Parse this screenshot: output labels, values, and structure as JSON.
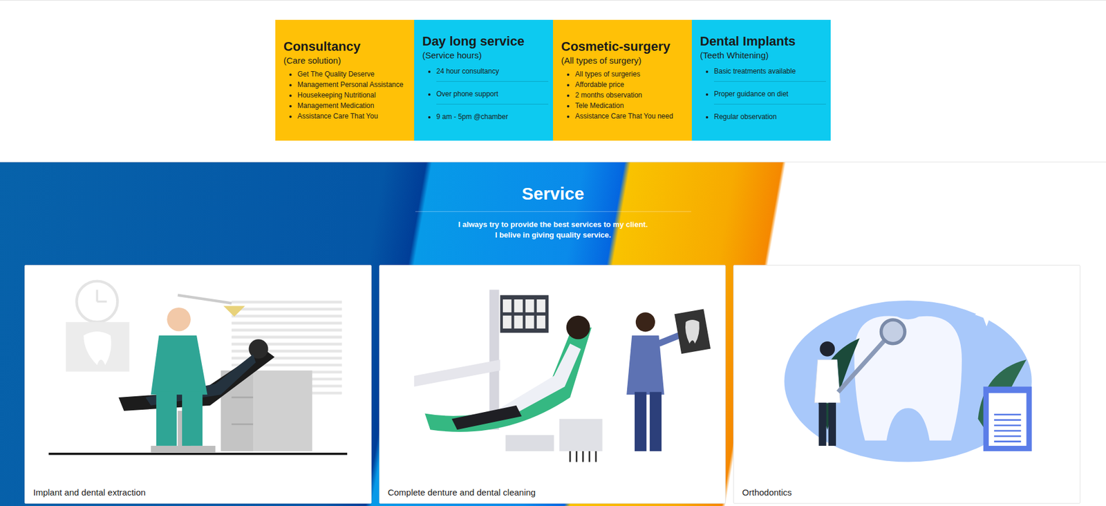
{
  "features": [
    {
      "title": "Consultancy",
      "subtitle": "(Care solution)",
      "color": "#ffc107",
      "kind": "plain",
      "items": [
        "Get The Quality Deserve",
        "Management Personal Assistance",
        "Housekeeping Nutritional",
        "Management Medication",
        "Assistance Care That You"
      ]
    },
    {
      "title": "Day long service",
      "subtitle": "(Service hours)",
      "color": "#0dcaf0",
      "kind": "divided",
      "items": [
        "24 hour consultancy",
        "Over phone support",
        "9 am - 5pm @chamber"
      ]
    },
    {
      "title": "Cosmetic-surgery",
      "subtitle": "(All types of surgery)",
      "color": "#ffc107",
      "kind": "plain",
      "items": [
        "All types of surgeries",
        "Affordable price",
        "2 months observation",
        "Tele Medication",
        "Assistance Care That You need"
      ]
    },
    {
      "title": "Dental Implants",
      "subtitle": "(Teeth Whitening)",
      "color": "#0dcaf0",
      "kind": "divided",
      "items": [
        "Basic treatments available",
        "Proper guidance on diet",
        "Regular observation"
      ]
    }
  ],
  "service": {
    "title": "Service",
    "lines": [
      "I always try to provide the best services to my client.",
      "I belive in giving quality service."
    ],
    "cards": [
      {
        "caption": "Implant and dental extraction"
      },
      {
        "caption": "Complete denture and dental cleaning"
      },
      {
        "caption": "Orthodontics"
      }
    ]
  }
}
